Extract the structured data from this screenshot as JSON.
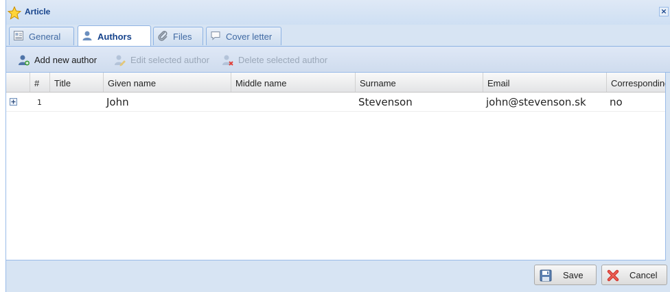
{
  "window": {
    "title": "Article",
    "close_label": "×"
  },
  "tabs": [
    {
      "label": "General",
      "icon": "form-icon"
    },
    {
      "label": "Authors",
      "icon": "user-icon",
      "active": true
    },
    {
      "label": "Files",
      "icon": "paperclip-icon"
    },
    {
      "label": "Cover letter",
      "icon": "speech-bubble-icon"
    }
  ],
  "toolbar": {
    "add": {
      "label": "Add new author",
      "icon": "add-user-icon"
    },
    "edit": {
      "label": "Edit selected author",
      "icon": "edit-user-icon"
    },
    "delete": {
      "label": "Delete selected author",
      "icon": "delete-user-icon"
    }
  },
  "grid": {
    "columns": [
      "#",
      "Title",
      "Given name",
      "Middle name",
      "Surname",
      "Email",
      "Corresponding"
    ],
    "rows": [
      {
        "num": "1",
        "title": "",
        "given": "John",
        "middle": "",
        "surname": "Stevenson",
        "email": "john@stevenson.sk",
        "corresponding": "no"
      }
    ]
  },
  "footer": {
    "save_label": "Save",
    "cancel_label": "Cancel"
  },
  "colors": {
    "accent": "#15428b",
    "border": "#99bbe8",
    "panel": "#d7e4f3"
  }
}
